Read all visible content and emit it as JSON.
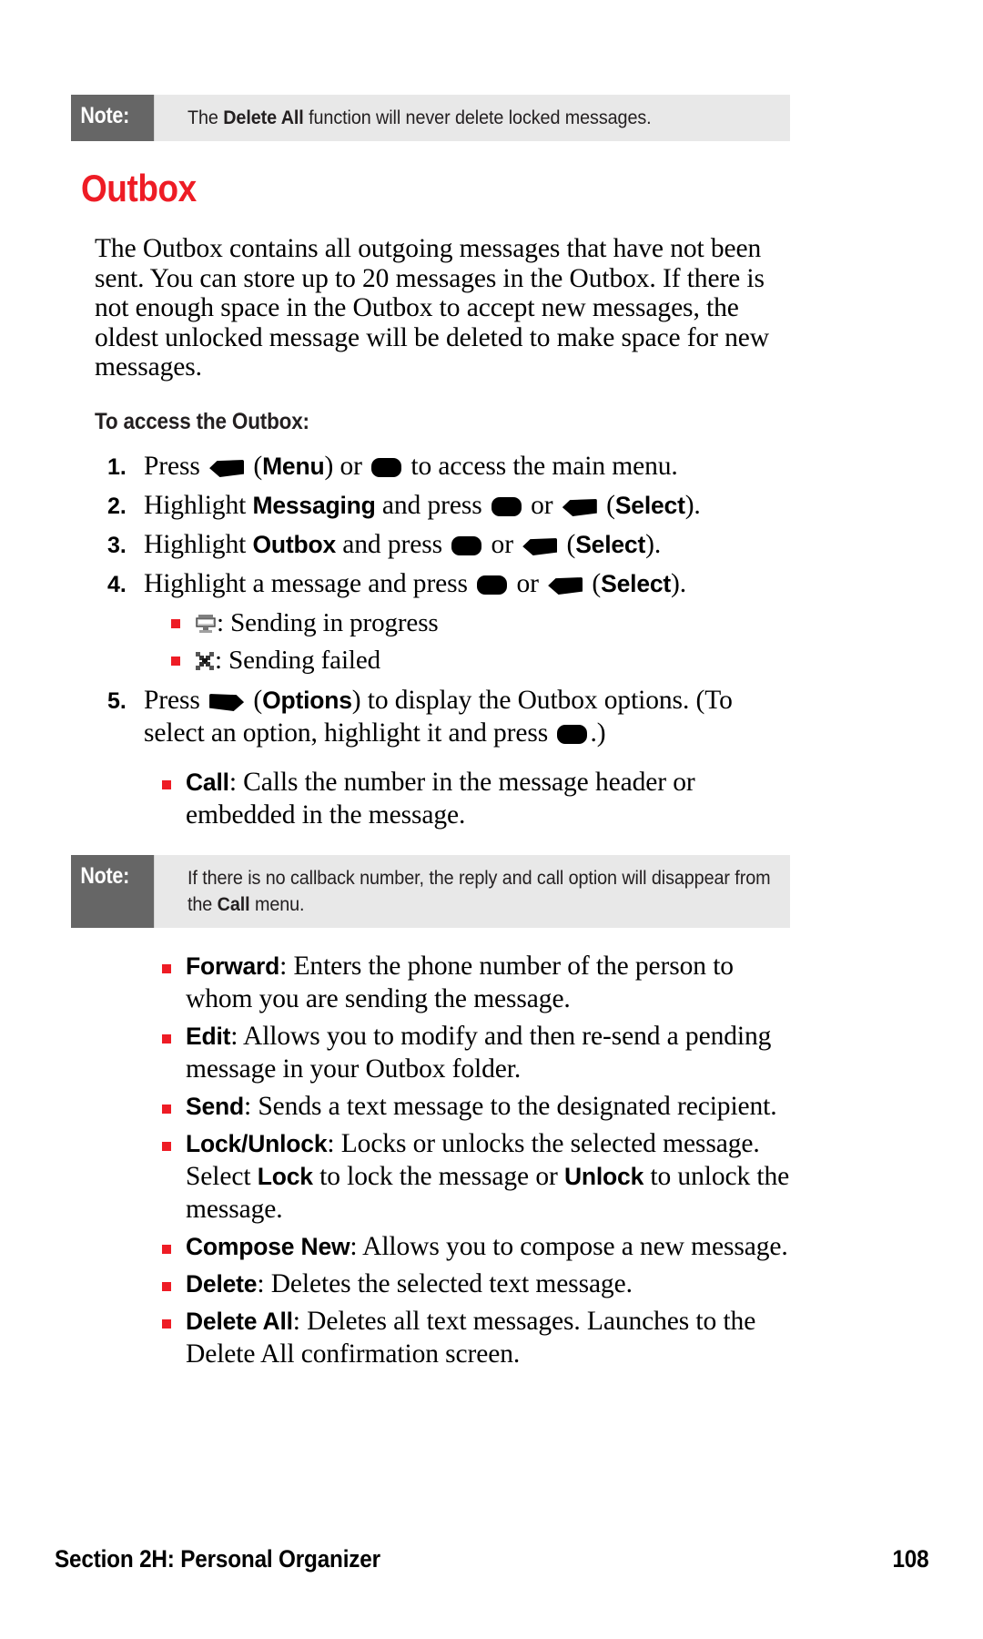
{
  "page": {
    "number": "108",
    "footer_section": "Section 2H: Personal Organizer"
  },
  "note_top": {
    "label": "Note:",
    "text_before": "The ",
    "text_bold": "Delete All",
    "text_after": " function will never delete locked messages."
  },
  "heading": "Outbox",
  "intro_paragraph": "The Outbox contains all outgoing messages that have not been sent. You can store up to 20 messages in the Outbox. If there is not enough space in the Outbox to accept new messages, the oldest unlocked message will be deleted to make space for new messages.",
  "sub_heading": "To access the Outbox:",
  "steps": [
    {
      "num": "1.",
      "parts": [
        {
          "t": "text",
          "v": "Press "
        },
        {
          "t": "icon",
          "v": "left-softkey-icon"
        },
        {
          "t": "text",
          "v": " ("
        },
        {
          "t": "bold",
          "v": "Menu"
        },
        {
          "t": "text",
          "v": ") or "
        },
        {
          "t": "icon",
          "v": "ok-key-icon"
        },
        {
          "t": "text",
          "v": " to access the main menu."
        }
      ]
    },
    {
      "num": "2.",
      "parts": [
        {
          "t": "text",
          "v": "Highlight "
        },
        {
          "t": "bold",
          "v": "Messaging"
        },
        {
          "t": "text",
          "v": " and press "
        },
        {
          "t": "icon",
          "v": "ok-key-icon"
        },
        {
          "t": "text",
          "v": " or "
        },
        {
          "t": "icon",
          "v": "left-softkey-icon"
        },
        {
          "t": "text",
          "v": " ("
        },
        {
          "t": "bold",
          "v": "Select"
        },
        {
          "t": "text",
          "v": ")."
        }
      ]
    },
    {
      "num": "3.",
      "parts": [
        {
          "t": "text",
          "v": "Highlight "
        },
        {
          "t": "bold",
          "v": "Outbox"
        },
        {
          "t": "text",
          "v": " and press "
        },
        {
          "t": "icon",
          "v": "ok-key-icon"
        },
        {
          "t": "text",
          "v": " or "
        },
        {
          "t": "icon",
          "v": "left-softkey-icon"
        },
        {
          "t": "text",
          "v": " ("
        },
        {
          "t": "bold",
          "v": "Select"
        },
        {
          "t": "text",
          "v": ")."
        }
      ]
    },
    {
      "num": "4.",
      "parts": [
        {
          "t": "text",
          "v": "Highlight a message and press "
        },
        {
          "t": "icon",
          "v": "ok-key-icon"
        },
        {
          "t": "text",
          "v": " or "
        },
        {
          "t": "icon",
          "v": "left-softkey-icon"
        },
        {
          "t": "text",
          "v": " ("
        },
        {
          "t": "bold",
          "v": "Select"
        },
        {
          "t": "text",
          "v": ")."
        }
      ]
    },
    {
      "num": "5.",
      "parts": [
        {
          "t": "text",
          "v": "Press "
        },
        {
          "t": "icon",
          "v": "right-softkey-icon"
        },
        {
          "t": "text",
          "v": " ("
        },
        {
          "t": "bold",
          "v": "Options"
        },
        {
          "t": "text",
          "v": ") to display the Outbox options. (To select an option, highlight it and press "
        },
        {
          "t": "icon",
          "v": "ok-key-icon"
        },
        {
          "t": "text",
          "v": ".)"
        }
      ]
    }
  ],
  "status_icons": [
    {
      "icon": "sending-in-progress-icon",
      "label": ": Sending in progress"
    },
    {
      "icon": "sending-failed-icon",
      "label": ": Sending failed"
    }
  ],
  "call_option": {
    "bold": "Call",
    "text": ": Calls the number in the message header or embedded in the message."
  },
  "note_bottom": {
    "label": "Note:",
    "text_before": "If there is no callback number, the reply and call option will disappear from the ",
    "text_bold": "Call",
    "text_after": " menu."
  },
  "options": [
    {
      "bold": "Forward",
      "text": ": Enters the phone number of the person to whom you are sending the message."
    },
    {
      "bold": "Edit",
      "text": ": Allows you to modify and then re-send a pending message in your Outbox folder."
    },
    {
      "bold": "Send",
      "text": ": Sends a text message to the designated recipient."
    },
    {
      "bold": "Lock/Unlock",
      "text": ": Locks or unlocks the selected message. Select ",
      "bold2": "Lock",
      "text2": " to lock the message or ",
      "bold3": "Unlock",
      "text3": " to unlock the message."
    },
    {
      "bold": "Compose New",
      "text": ": Allows you to compose a new message."
    },
    {
      "bold": "Delete",
      "text": ": Deletes the selected text message."
    },
    {
      "bold": "Delete All",
      "text": ": Deletes all text messages. Launches to the Delete All confirmation screen."
    }
  ],
  "colors": {
    "accent_red": "#ee1c25",
    "note_label_bg": "#666666",
    "note_body_bg": "#e8e8e8"
  }
}
